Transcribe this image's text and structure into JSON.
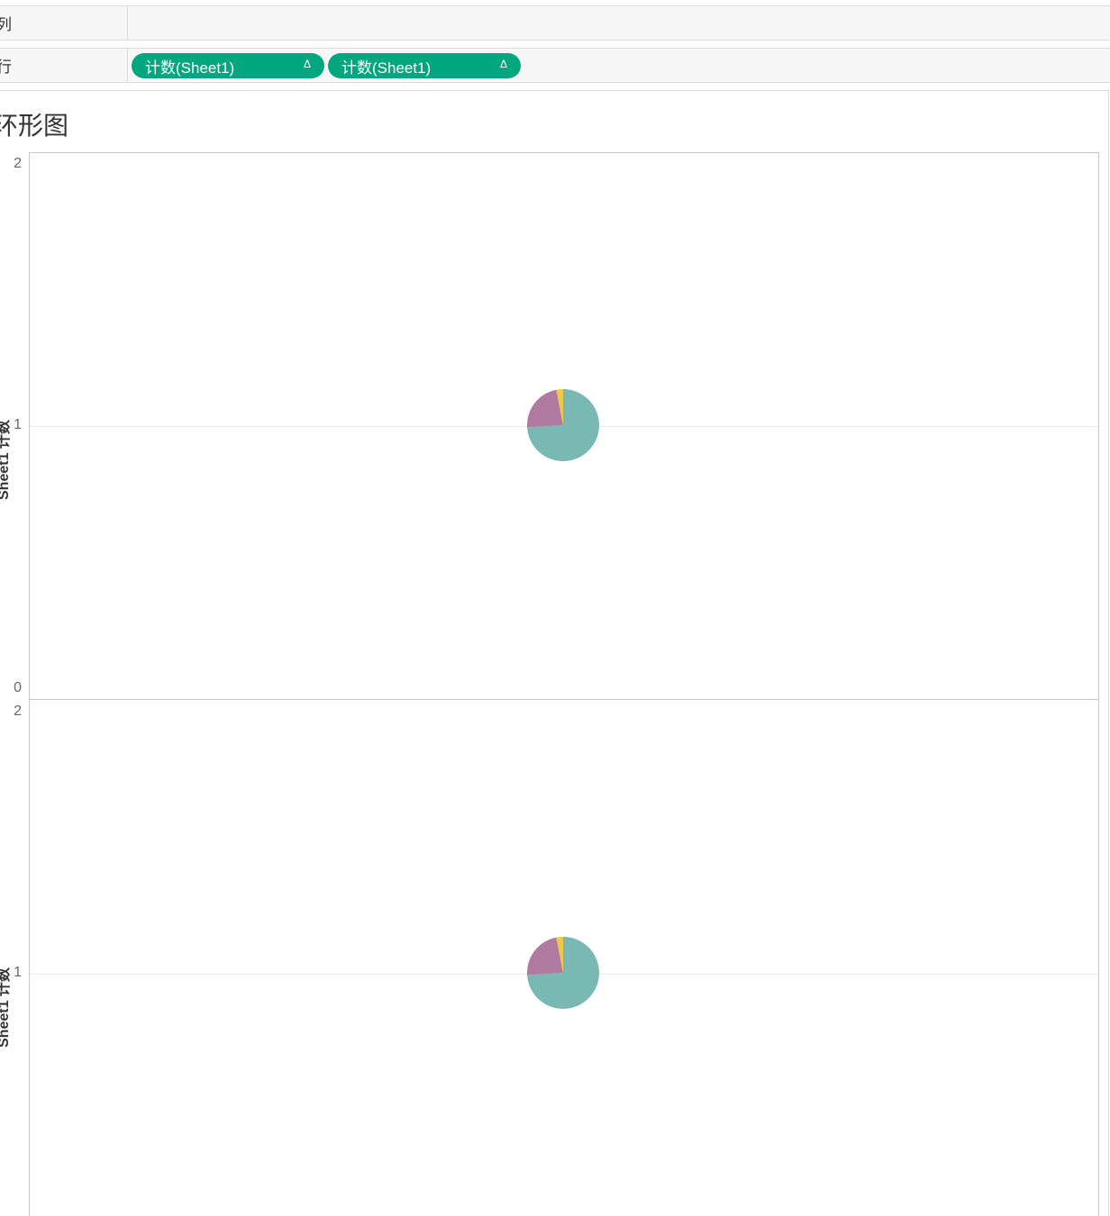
{
  "shelves": {
    "columns": {
      "label": "列"
    },
    "rows": {
      "label": "行",
      "pills": [
        {
          "label": "计数(Sheet1)",
          "delta": "Δ"
        },
        {
          "label": "计数(Sheet1)",
          "delta": "Δ"
        }
      ]
    }
  },
  "sheet": {
    "title": "环形图"
  },
  "axis": {
    "title": "Sheet1 计数",
    "ticks_top": [
      "2",
      "1",
      "0"
    ],
    "ticks_bottom": [
      "2",
      "1"
    ]
  },
  "colors": {
    "pill": "#00a67e",
    "teal": "#79b8b3",
    "purple": "#b07aa1",
    "yellow": "#edc948"
  },
  "chart_data": [
    {
      "type": "pie",
      "ylim": [
        0,
        2
      ],
      "y": 1,
      "slices": [
        {
          "color": "#79b8b3",
          "value": 0.74
        },
        {
          "color": "#b07aa1",
          "value": 0.23
        },
        {
          "color": "#edc948",
          "value": 0.03
        }
      ]
    },
    {
      "type": "pie",
      "ylim": [
        0,
        2
      ],
      "y": 1,
      "slices": [
        {
          "color": "#79b8b3",
          "value": 0.74
        },
        {
          "color": "#b07aa1",
          "value": 0.23
        },
        {
          "color": "#edc948",
          "value": 0.03
        }
      ]
    }
  ]
}
